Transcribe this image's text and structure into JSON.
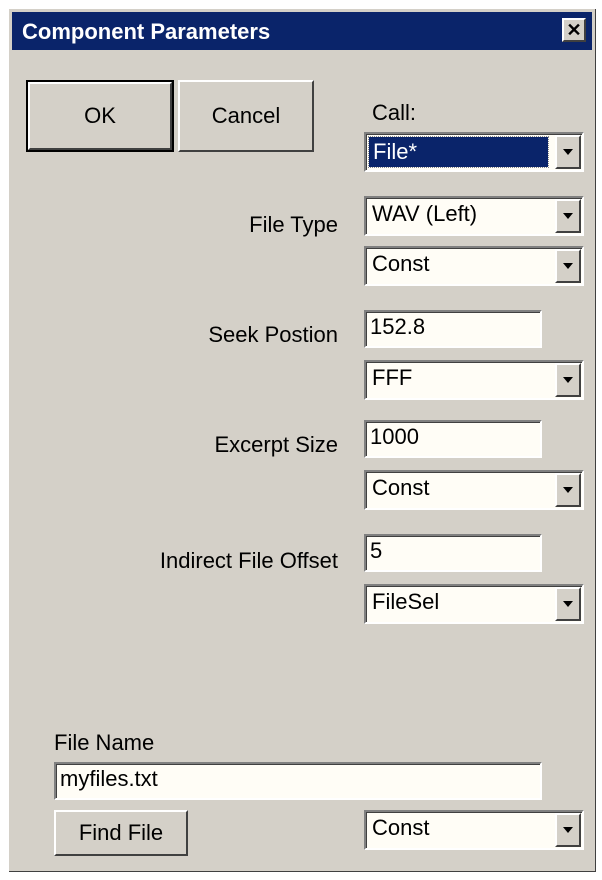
{
  "window": {
    "title": "Component Parameters",
    "close_symbol": "✕"
  },
  "buttons": {
    "ok": "OK",
    "cancel": "Cancel",
    "find_file": "Find File"
  },
  "call": {
    "label": "Call:",
    "value": "File*"
  },
  "file_type": {
    "label": "File Type",
    "value": "WAV (Left)",
    "mode": "Const"
  },
  "seek_position": {
    "label": "Seek Postion",
    "value": "152.8",
    "mode": "FFF"
  },
  "excerpt_size": {
    "label": "Excerpt Size",
    "value": "1000",
    "mode": "Const"
  },
  "indirect_offset": {
    "label": "Indirect File Offset",
    "value": "5",
    "mode": "FileSel"
  },
  "file_name": {
    "label": "File Name",
    "value": "myfiles.txt",
    "mode": "Const"
  },
  "colors": {
    "titlebar": "#0a246a",
    "face": "#d4d0c8",
    "field": "#fffdf6"
  }
}
